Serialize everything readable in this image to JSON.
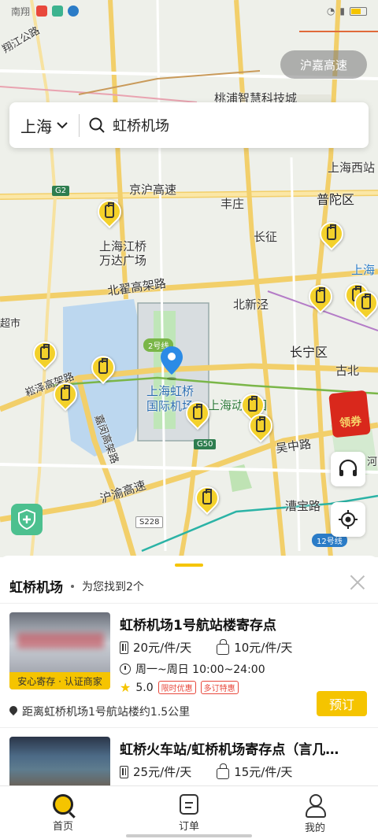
{
  "status_bar": {
    "carrier_text": "南翔"
  },
  "map": {
    "route_pill": "沪嘉高速",
    "labels": {
      "road_top": "翔江公路",
      "tech_town": "桃浦智慧科技城",
      "shanghai_west": "上海西站",
      "jinghu": "京沪高速",
      "putuo": "普陀区",
      "fengzhuang": "丰庄",
      "changzheng": "长征",
      "wanda": "上海江桥\n万达广场",
      "beizhai": "北翟高架路",
      "beixinjing": "北新泾",
      "changning": "长宁区",
      "gubei": "古北",
      "songze": "崧泽高架路",
      "airport": "上海虹桥\n国际机场",
      "shanghai_zoo": "上海动物园",
      "jiagang": "嘉闵高架路",
      "wuzhong": "吴中路",
      "huyu": "沪渝高速",
      "caobao": "漕宝路",
      "shanghai_right": "上海",
      "chaoshi": "超市",
      "lianghe": "河"
    },
    "signs": {
      "g2": "G2",
      "g50": "G50",
      "s228": "S228",
      "line2": "2号线",
      "line12": "12号线"
    },
    "coupon_label": "领券"
  },
  "search": {
    "city": "上海",
    "query": "虹桥机场"
  },
  "results": {
    "title": "虹桥机场",
    "count_text": "为您找到2个",
    "items": [
      {
        "name": "虹桥机场1号航站楼寄存点",
        "suitcase_price": "20元/件/天",
        "bag_price": "10元/件/天",
        "hours": "周一~周日 10:00~24:00",
        "rating": "5.0",
        "badges": [
          "限时优惠",
          "多订特惠"
        ],
        "tag": "安心寄存 · 认证商家",
        "distance": "距离虹桥机场1号航站楼约1.5公里",
        "book_label": "预订"
      },
      {
        "name": "虹桥火车站/虹桥机场寄存点（言几…",
        "suitcase_price": "25元/件/天",
        "bag_price": "15元/件/天"
      }
    ]
  },
  "tabs": [
    {
      "label": "首页",
      "icon": "home-search-icon"
    },
    {
      "label": "订单",
      "icon": "order-icon"
    },
    {
      "label": "我的",
      "icon": "profile-icon"
    }
  ],
  "colors": {
    "accent": "#f5c400",
    "pin": "#f3d12b",
    "coupon": "#d9281c",
    "shield": "#4cc08f"
  }
}
